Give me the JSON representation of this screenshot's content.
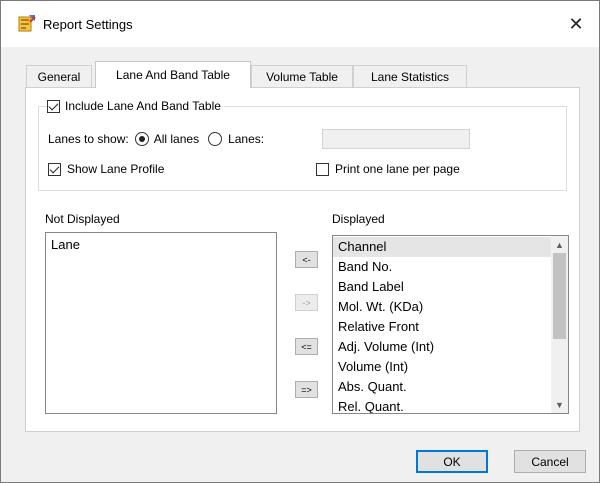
{
  "window": {
    "title": "Report Settings"
  },
  "tabs": [
    {
      "label": "General"
    },
    {
      "label": "Lane And Band Table"
    },
    {
      "label": "Volume Table"
    },
    {
      "label": "Lane Statistics"
    }
  ],
  "active_tab": "Lane And Band Table",
  "lane_band_group": {
    "include_label": "Include Lane And Band Table",
    "include_checked": true,
    "lanes_to_show_label": "Lanes to show:",
    "all_lanes_label": "All lanes",
    "lanes_label": "Lanes:",
    "lanes_value": "",
    "selected_lane_option": "All lanes",
    "show_lane_profile_label": "Show Lane Profile",
    "show_lane_profile_checked": true,
    "print_one_lane_label": "Print one lane per page",
    "print_one_lane_checked": false
  },
  "not_displayed": {
    "label": "Not Displayed",
    "items": [
      "Lane"
    ]
  },
  "displayed": {
    "label": "Displayed",
    "items": [
      "Channel",
      "Band No.",
      "Band Label",
      "Mol. Wt. (KDa)",
      "Relative Front",
      "Adj. Volume (Int)",
      "Volume (Int)",
      "Abs. Quant.",
      "Rel. Quant."
    ],
    "selected": "Channel"
  },
  "move_buttons": {
    "move_left": "<-",
    "move_right": "->",
    "move_all_left": "<=",
    "move_all_right": "=>"
  },
  "footer": {
    "ok_label": "OK",
    "cancel_label": "Cancel"
  },
  "colors": {
    "accent": "#0078d7",
    "selection": "#e5e5e5",
    "dialog_bg": "#f0f0f0",
    "panel_bg": "#ffffff"
  }
}
